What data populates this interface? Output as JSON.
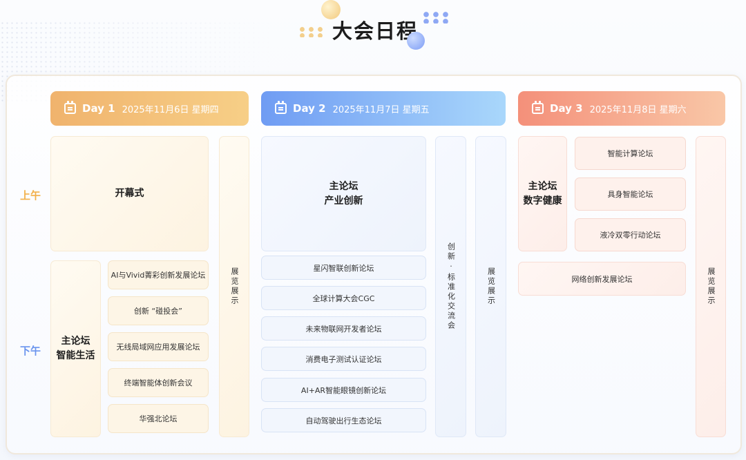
{
  "page_title": "大会日程",
  "period_labels": {
    "am": "上午",
    "pm": "下午"
  },
  "days": [
    {
      "label": "Day 1",
      "date": "2025年11月6日 星期四",
      "color": "#f0b36d"
    },
    {
      "label": "Day 2",
      "date": "2025年11月7日 星期五",
      "color": "#6f9cf3"
    },
    {
      "label": "Day 3",
      "date": "2025年11月8日 星期六",
      "color": "#f4907a"
    }
  ],
  "day1": {
    "opening": "开幕式",
    "main_forum": {
      "line1": "主论坛",
      "line2": "智能生活"
    },
    "forums": [
      "AI与Vivid菁彩创新发展论坛",
      "创新 “碰投会”",
      "无线局域网应用发展论坛",
      "终端智能体创新会议",
      "华强北论坛"
    ],
    "exhibit": "展览展示"
  },
  "day2": {
    "main_forum": {
      "line1": "主论坛",
      "line2": "产业创新"
    },
    "forums": [
      "星闪智联创新论坛",
      "全球计算大会CGC",
      "未来物联网开发者论坛",
      "消费电子测试认证论坛",
      "AI+AR智能眼镜创新论坛",
      "自动驾驶出行生态论坛"
    ],
    "standards": "创新·标准化交流会",
    "exhibit": "展览展示"
  },
  "day3": {
    "main_forum": {
      "line1": "主论坛",
      "line2": "数字健康"
    },
    "forums": [
      "智能计算论坛",
      "具身智能论坛",
      "液冷双零行动论坛"
    ],
    "network_forum": "网络创新发展论坛",
    "exhibit": "展览展示"
  }
}
